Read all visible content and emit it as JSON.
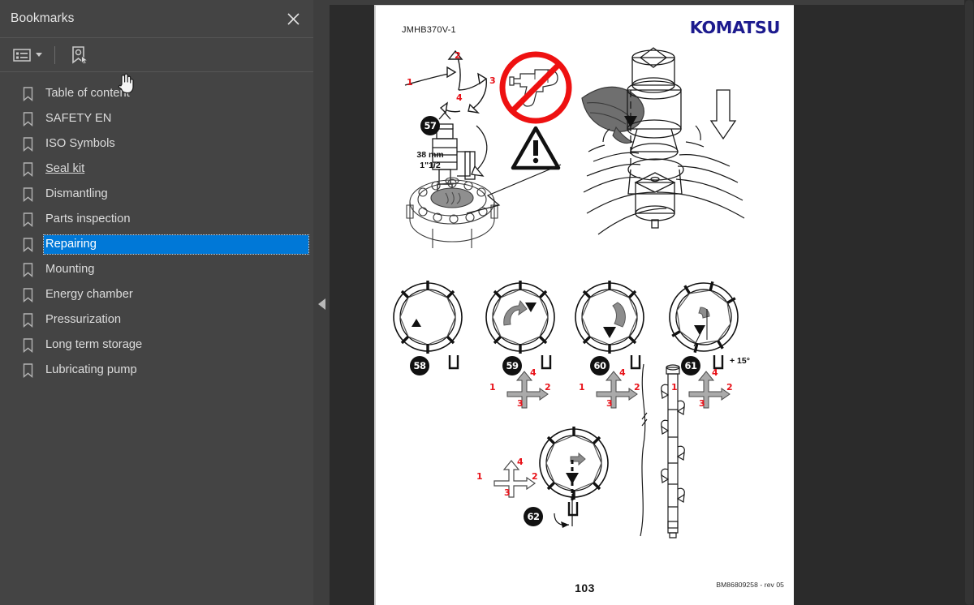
{
  "sidebar": {
    "title": "Bookmarks",
    "close_icon": "close-icon",
    "toolbar": {
      "options_label": "Bookmark options",
      "options_icon": "list-options-icon",
      "new_bookmark_label": "New bookmark",
      "new_bookmark_icon": "new-bookmark-icon"
    },
    "items": [
      {
        "label": "Table of content",
        "state": "normal"
      },
      {
        "label": "SAFETY EN",
        "state": "normal"
      },
      {
        "label": "ISO Symbols",
        "state": "normal"
      },
      {
        "label": "Seal kit",
        "state": "visited"
      },
      {
        "label": "Dismantling",
        "state": "normal"
      },
      {
        "label": "Parts inspection",
        "state": "normal"
      },
      {
        "label": "Repairing",
        "state": "selected"
      },
      {
        "label": "Mounting",
        "state": "normal"
      },
      {
        "label": "Energy chamber",
        "state": "normal"
      },
      {
        "label": "Pressurization",
        "state": "normal"
      },
      {
        "label": "Long term storage",
        "state": "normal"
      },
      {
        "label": "Lubricating pump",
        "state": "normal"
      }
    ]
  },
  "splitter": {
    "collapse_icon": "collapse-left-arrow-icon",
    "collapse_label": "Collapse panel"
  },
  "viewer": {
    "scrollbar_label": "Vertical scrollbar"
  },
  "page": {
    "doc_code": "JMHB370V-1",
    "brand": "KOMATSU",
    "page_number": "103",
    "revision": "BM86809258 - rev 05",
    "figures": {
      "tool_spec_mm": "38 mm",
      "tool_spec_inch": "1\"1/2",
      "angle_note": "+ 15°",
      "arrow_numbers": [
        "1",
        "2",
        "3",
        "4"
      ],
      "rotation_numbers": [
        "1",
        "2",
        "3",
        "4"
      ],
      "no_impact_wrench_icon": "prohibited-impact-wrench-icon",
      "warning_icon": "warning-triangle-icon"
    },
    "steps": [
      {
        "id": "57"
      },
      {
        "id": "58"
      },
      {
        "id": "59"
      },
      {
        "id": "60"
      },
      {
        "id": "61"
      },
      {
        "id": "62"
      }
    ]
  },
  "cursor": {
    "type": "pointing-hand-cursor"
  },
  "colors": {
    "selection": "#0078d7",
    "sidebar_bg": "#444444",
    "viewer_bg": "#2b2b2b",
    "brand": "#1c1a8e",
    "red_annotation": "#e8131a"
  }
}
